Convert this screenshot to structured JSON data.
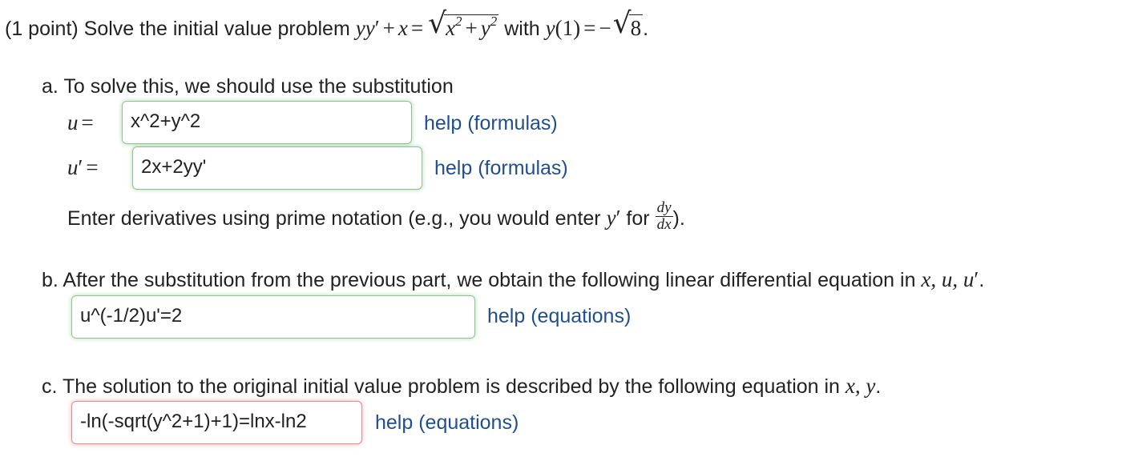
{
  "problem": {
    "prefix": "(1 point) Solve the initial value problem ",
    "with_word": " with ",
    "eq_lhs_a": "yy",
    "prime": "′",
    "plus": "+",
    "x": "x",
    "equals": "=",
    "sqrt_x": "x",
    "sqrt_plus": "+",
    "sqrt_y": "y",
    "exp2": "2",
    "cond_y": "y",
    "cond_arg": "(1)",
    "cond_equals": "=",
    "cond_minus": "−",
    "cond_root": "8",
    "period": "."
  },
  "part_a": {
    "intro": "a. To solve this, we should use the substitution",
    "u_label_var": "u",
    "u_label_eq": "=",
    "u_value": "x^2+y^2",
    "up_label_var": "u",
    "up_label_prime": "′",
    "up_label_eq": "=",
    "up_value": "2x+2yy'",
    "help_u": "help (formulas)",
    "help_up": "help (formulas)",
    "note_prefix": "Enter derivatives using prime notation (e.g., you would enter ",
    "note_y": "y",
    "note_prime": "′",
    "note_for": " for ",
    "note_num": "dy",
    "note_den": "dx",
    "note_suffix": ")."
  },
  "part_b": {
    "intro": "b. After the substitution from the previous part, we obtain the following linear differential equation in ",
    "vars": "x, u, u",
    "vars_prime": "′",
    "period": ".",
    "value": "u^(-1/2)u'=2",
    "help": "help (equations)"
  },
  "part_c": {
    "intro": "c. The solution to the original initial value problem is described by the following equation in ",
    "vars": "x, y",
    "period": ".",
    "value": "-ln(-sqrt(y^2+1)+1)=lnx-ln2",
    "help": "help (equations)"
  }
}
